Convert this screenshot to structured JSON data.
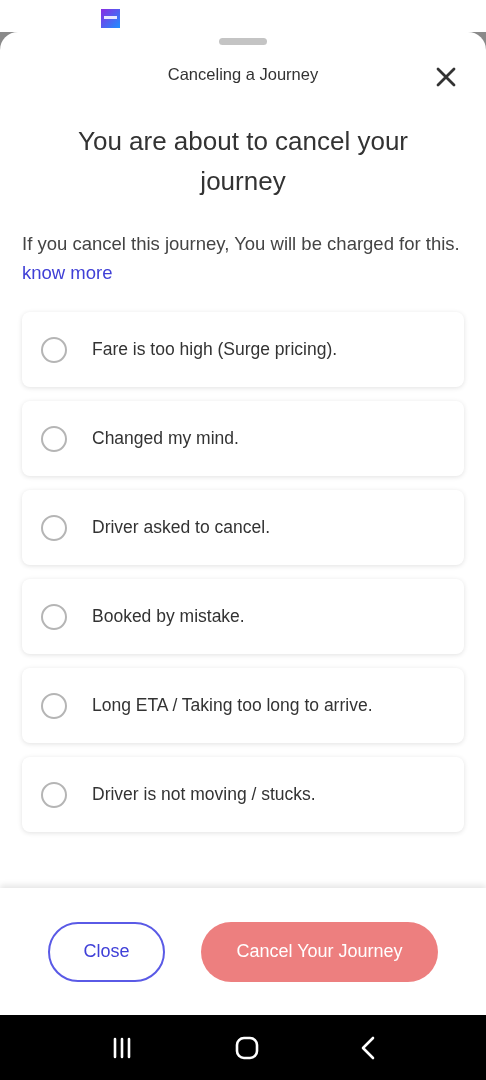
{
  "sheet": {
    "title": "Canceling a Journey"
  },
  "heading": "You are about to cancel your journey",
  "notice": {
    "text": "If you cancel this journey, You will be charged for this.",
    "link": "know more"
  },
  "reasons": [
    {
      "label": "Fare is too high (Surge pricing).",
      "selected": false
    },
    {
      "label": "Changed my mind.",
      "selected": false
    },
    {
      "label": "Driver asked to cancel.",
      "selected": false
    },
    {
      "label": "Booked by mistake.",
      "selected": false
    },
    {
      "label": "Long ETA / Taking too long to arrive.",
      "selected": false
    },
    {
      "label": "Driver is not moving / stucks.",
      "selected": false
    }
  ],
  "buttons": [
    {
      "label": "Close",
      "kind": "outline",
      "disabled": false
    },
    {
      "label": "Cancel Your Journey",
      "kind": "primary",
      "disabled": true
    }
  ]
}
